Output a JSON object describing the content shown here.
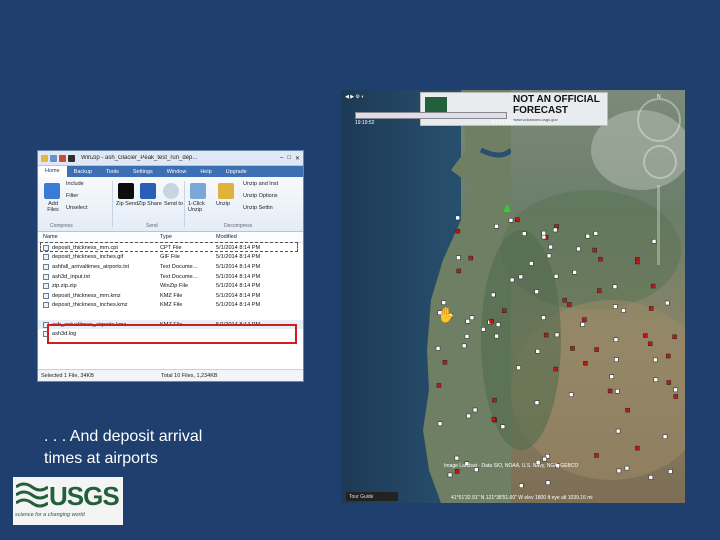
{
  "winzip": {
    "title": "WinZip - ash_Glacier_Peak_test_run_dep...",
    "window_controls": [
      "–",
      "□",
      "✕"
    ],
    "tabs": [
      "Home",
      "Backup",
      "Tools",
      "Settings",
      "Window",
      "Help",
      "Upgrade"
    ],
    "ribbon": {
      "add_files": "Add Files",
      "include": "Include",
      "filter": "Filter",
      "unselect": "Unselect",
      "zipsend": "Zip Send",
      "zipshare": "Zip Share",
      "send_to": "Send to",
      "one_click_unzip": "1-Click Unzip",
      "unzip_to": "Unzip",
      "unzip_and_install": "Unzip and Inst",
      "unzip_options": "Unzip Options",
      "select_unzip": "Unzip Settin",
      "group_compress": "Compress",
      "group_send": "Send",
      "group_decompress": "Decompress"
    },
    "columns": [
      "Name",
      "Type",
      "Modified"
    ],
    "rows": [
      {
        "name": "deposit_thickness_mm.cpt",
        "type": "CPT File",
        "modified": "5/1/2014 8:14 PM"
      },
      {
        "name": "deposit_thickness_inches.gif",
        "type": "GIF File",
        "modified": "5/1/2014 8:14 PM"
      },
      {
        "name": "ashfall_arrivaltimes_airports.txt",
        "type": "Text Docume...",
        "modified": "5/1/2014 8:14 PM"
      },
      {
        "name": "ash3d_input.txt",
        "type": "Text Docume...",
        "modified": "5/1/2014 8:14 PM"
      },
      {
        "name": "zip.zip.zip",
        "type": "WinZip File",
        "modified": "5/1/2014 8:14 PM"
      },
      {
        "name": "deposit_thickness_mm.kmz",
        "type": "KMZ File",
        "modified": "5/1/2014 8:14 PM"
      },
      {
        "name": "deposit_thickness_inches.kmz",
        "type": "KMZ File",
        "modified": "5/1/2014 8:14 PM"
      },
      {
        "name": "",
        "type": "",
        "modified": ""
      },
      {
        "name": "ash_arrivaltimes_airports.kmz",
        "type": "KMZ File",
        "modified": "5/1/2014 8:14 PM"
      },
      {
        "name": "ash3d.log",
        "type": "",
        "modified": ""
      }
    ],
    "status_left": "Selected 1 File, 34KB",
    "status_right": "Total 10 Files, 1,234KB"
  },
  "map": {
    "banner_line1": "NOT AN OFFICIAL",
    "banner_line2": "FORECAST",
    "banner_line3": "www.volcanoes.usgs.gov",
    "timeline_left": "19:19:52",
    "timeline_right": "4/10:13:53",
    "timeline_top_left": "5/1/2014 12:19:52",
    "nav_north": "N",
    "tour_guide": "Tour Guide",
    "copyright": "Image Landsat · Data SIO, NOAA, U.S. Navy, NGA, GEBCO",
    "status": "41°51'32.91\" N  121°38'51.60\" W  elev 1800 ft    eye alt 1039.16 mi",
    "colors": {
      "airport_white": "#ffffff",
      "airport_red": "#c01818",
      "volcano": "#33cc33"
    }
  },
  "caption": {
    "line1": ". . . And deposit arrival",
    "line2": "times at airports"
  },
  "logo": {
    "name": "USGS",
    "tagline": "science for a changing world"
  }
}
